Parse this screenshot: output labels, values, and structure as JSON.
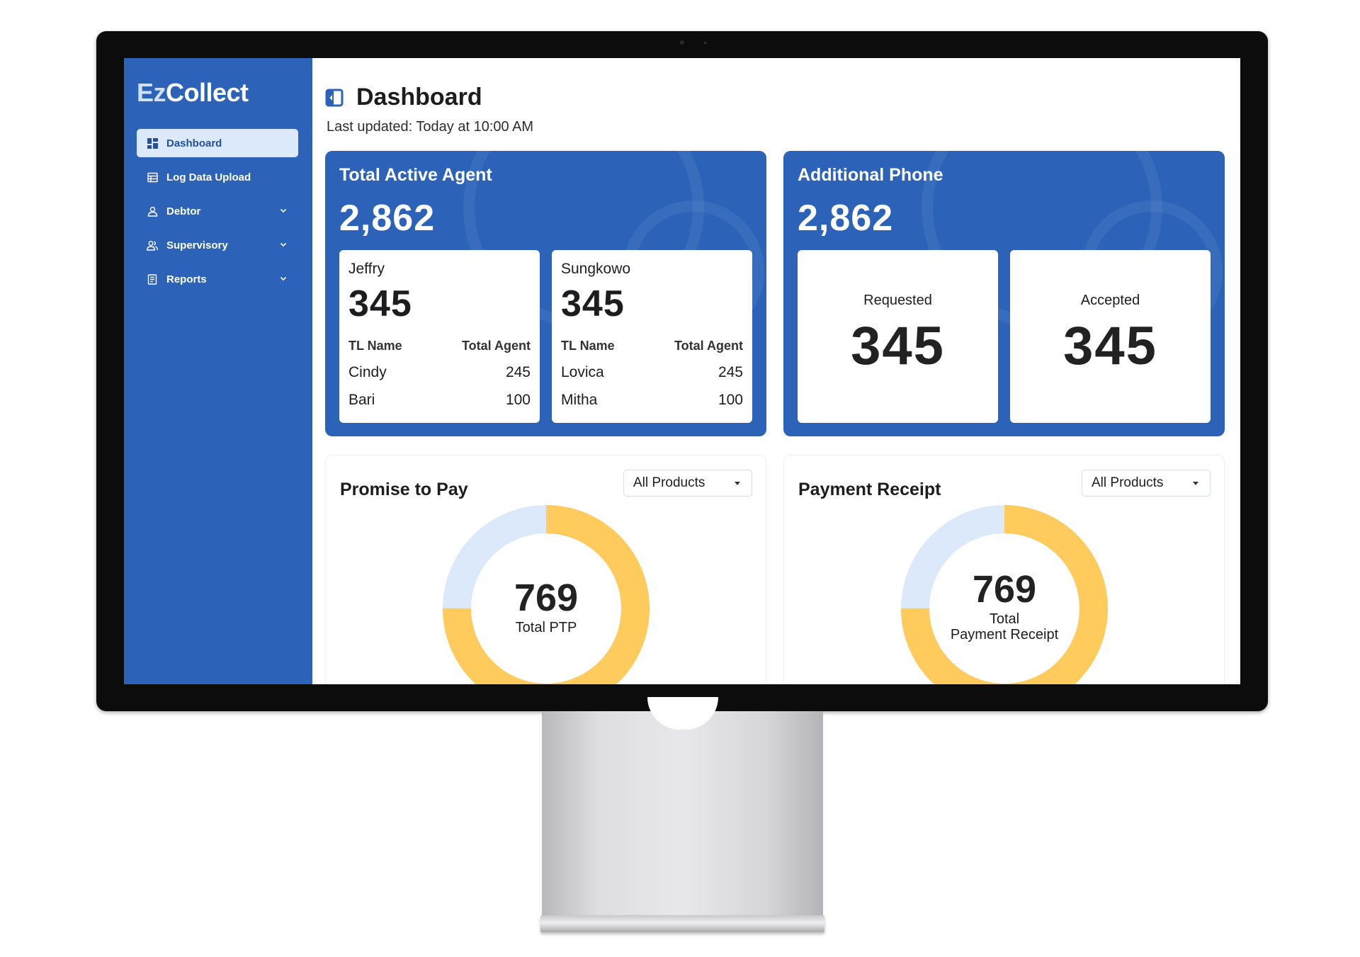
{
  "app": {
    "logo_prefix": "Ez",
    "logo_suffix": "Collect"
  },
  "sidebar": {
    "items": [
      {
        "label": "Dashboard",
        "icon": "grid-icon",
        "active": true
      },
      {
        "label": "Log Data Upload",
        "icon": "table-icon"
      },
      {
        "label": "Debtor",
        "icon": "user-icon",
        "expandable": true
      },
      {
        "label": "Supervisory",
        "icon": "users-icon",
        "expandable": true
      },
      {
        "label": "Reports",
        "icon": "report-icon",
        "expandable": true
      }
    ]
  },
  "header": {
    "title": "Dashboard",
    "last_updated": "Last updated: Today at 10:00 AM"
  },
  "active_agent": {
    "title": "Total Active Agent",
    "total": "2,862",
    "leaders": [
      {
        "name": "Jeffry",
        "count": "345",
        "col_name": "TL Name",
        "col_total": "Total Agent",
        "rows": [
          {
            "name": "Cindy",
            "value": "245"
          },
          {
            "name": "Bari",
            "value": "100"
          }
        ]
      },
      {
        "name": "Sungkowo",
        "count": "345",
        "col_name": "TL Name",
        "col_total": "Total Agent",
        "rows": [
          {
            "name": "Lovica",
            "value": "245"
          },
          {
            "name": "Mitha",
            "value": "100"
          }
        ]
      }
    ]
  },
  "additional_phone": {
    "title": "Additional Phone",
    "total": "2,862",
    "requested_label": "Requested",
    "requested_value": "345",
    "accepted_label": "Accepted",
    "accepted_value": "345"
  },
  "promise_to_pay": {
    "title": "Promise to Pay",
    "filter": "All Products",
    "total": "769",
    "label": "Total PTP",
    "share_primary": 0.75
  },
  "payment_receipt": {
    "title": "Payment Receipt",
    "filter": "All Products",
    "total": "769",
    "label_line1": "Total",
    "label_line2": "Payment Receipt",
    "share_primary": 0.75
  },
  "colors": {
    "brand_blue": "#2c63b8",
    "active_nav_bg": "#dce9fb",
    "donut_primary": "#fecb5c",
    "donut_secondary": "#dce9fb"
  }
}
